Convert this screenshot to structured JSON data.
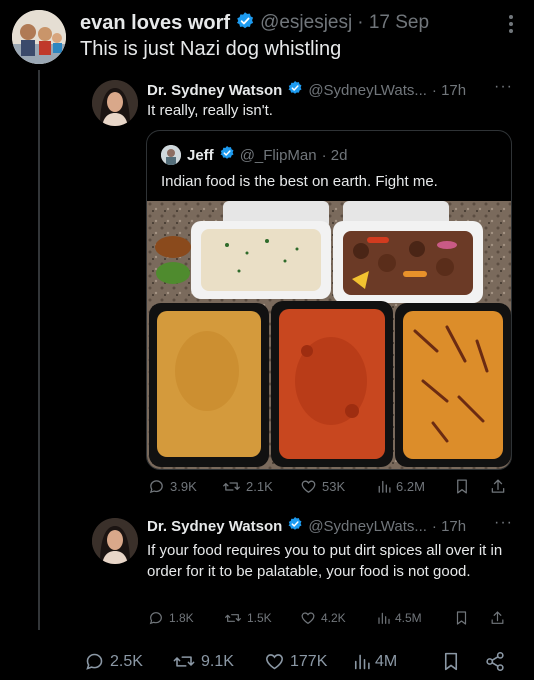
{
  "main_tweet": {
    "author_name": "evan loves worf",
    "handle": "@esjesjesj",
    "date": "· 17 Sep",
    "text": "This is just Nazi dog whistling",
    "stats": {
      "replies": "2.5K",
      "retweets": "9.1K",
      "likes": "177K",
      "views": "4M"
    }
  },
  "reply_1": {
    "author_name": "Dr. Sydney Watson",
    "handle": "@SydneyLWats...",
    "time": "· 17h",
    "text": "It really, really isn't.",
    "quoted": {
      "author_name": "Jeff",
      "handle": "@_FlipMan",
      "time": "· 2d",
      "text": "Indian food is the best on earth. Fight me."
    },
    "stats": {
      "replies": "3.9K",
      "retweets": "2.1K",
      "likes": "53K",
      "views": "6.2M"
    }
  },
  "reply_2": {
    "author_name": "Dr. Sydney Watson",
    "handle": "@SydneyLWats...",
    "time": "· 17h",
    "text": "If your food requires you to put dirt spices all over it in order for it to be palatable, your food is not good.",
    "stats": {
      "replies": "1.8K",
      "retweets": "1.5K",
      "likes": "4.2K",
      "views": "4.5M"
    }
  },
  "colors": {
    "background": "#000000",
    "text": "#e7e9ea",
    "muted": "#71767b",
    "verified": "#1d9bf0",
    "border": "#2f3336"
  },
  "icons": [
    "verified-badge-icon",
    "more-icon",
    "reply-icon",
    "retweet-icon",
    "like-icon",
    "views-icon",
    "bookmark-icon",
    "share-icon"
  ]
}
